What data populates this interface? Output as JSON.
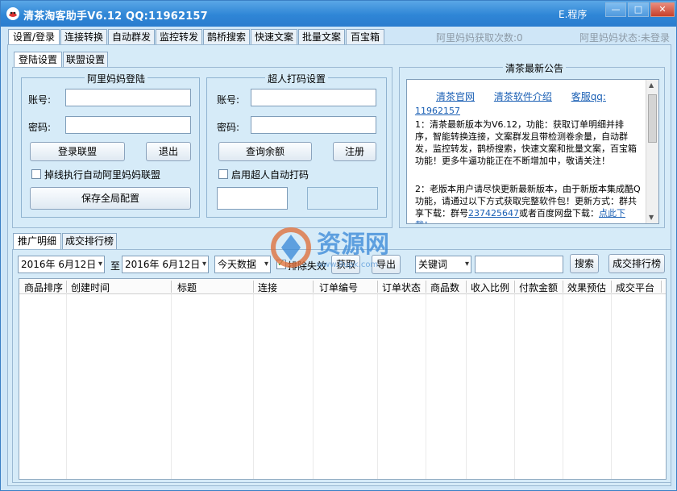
{
  "window": {
    "title": "清茶淘客助手V6.12 QQ:11962157",
    "menu_label": "E.程序",
    "min_label": "—",
    "max_label": "□",
    "close_label": "✕"
  },
  "main_tabs": [
    "设置/登录",
    "连接转换",
    "自动群发",
    "监控转发",
    "鹊桥搜索",
    "快速文案",
    "批量文案",
    "百宝箱"
  ],
  "status": {
    "alimama_count": "阿里妈妈获取次数:0",
    "alimama_state": "阿里妈妈状态:未登录"
  },
  "sub_tabs": [
    "登陆设置",
    "联盟设置"
  ],
  "alimama_login": {
    "title": "阿里妈妈登陆",
    "account_label": "账号:",
    "password_label": "密码:",
    "account_value": "",
    "password_value": "",
    "login_button": "登录联盟",
    "logout_button": "退出",
    "auto_login_checkbox": "掉线执行自动阿里妈妈联盟",
    "save_button": "保存全局配置"
  },
  "captcha": {
    "title": "超人打码设置",
    "account_label": "账号:",
    "password_label": "密码:",
    "account_value": "",
    "password_value": "",
    "balance_button": "查询余额",
    "register_button": "注册",
    "enable_checkbox": "启用超人自动打码",
    "field1": "",
    "field2": ""
  },
  "notice": {
    "title": "清茶最新公告",
    "links": [
      "清茶官网",
      "清茶软件介绍",
      "客服qq:"
    ],
    "qq": "11962157",
    "paragraph1": "1：清茶最新版本为V6.12，功能：获取订单明细并排序，智能转换连接，文案群发且带检测卷余量，自动群发，监控转发，鹊桥搜索，快速文案和批量文案，百宝箱功能！更多牛逼功能正在不断增加中，敬请关注！",
    "paragraph2_prefix": "2：老版本用户请尽快更新最新版本，由于新版本集成酷Q功能，请通过以下方式获取完整软件包！更新方式：群共享下载：群号",
    "paragraph2_link": "237425647",
    "paragraph2_suffix": "或者百度网盘下载：",
    "paragraph2_more": "点此下载！"
  },
  "bottom_tabs": [
    "推广明细",
    "成交排行榜"
  ],
  "filters": {
    "date_from": "2016年  6月12日",
    "date_sep": "至",
    "date_to": "2016年  6月12日",
    "range_select": "今天数据",
    "exclude_checkbox": "排除失效",
    "fetch_button": "获取",
    "export_button": "导出",
    "keyword_select": "关键词",
    "keyword_value": "",
    "search_button": "搜索",
    "ranking_button": "成交排行榜"
  },
  "table": {
    "columns": [
      "商品排序",
      "创建时间",
      "标题",
      "连接",
      "订单编号",
      "订单状态",
      "商品数",
      "收入比例",
      "付款金额",
      "效果预估",
      "成交平台"
    ],
    "rows": []
  },
  "watermark": {
    "text": "资源网",
    "subtext": "www.9upk.com"
  },
  "colors": {
    "titlebar": "#2f86d6",
    "panel": "#d6ebf8",
    "link": "#1a5fb4"
  }
}
